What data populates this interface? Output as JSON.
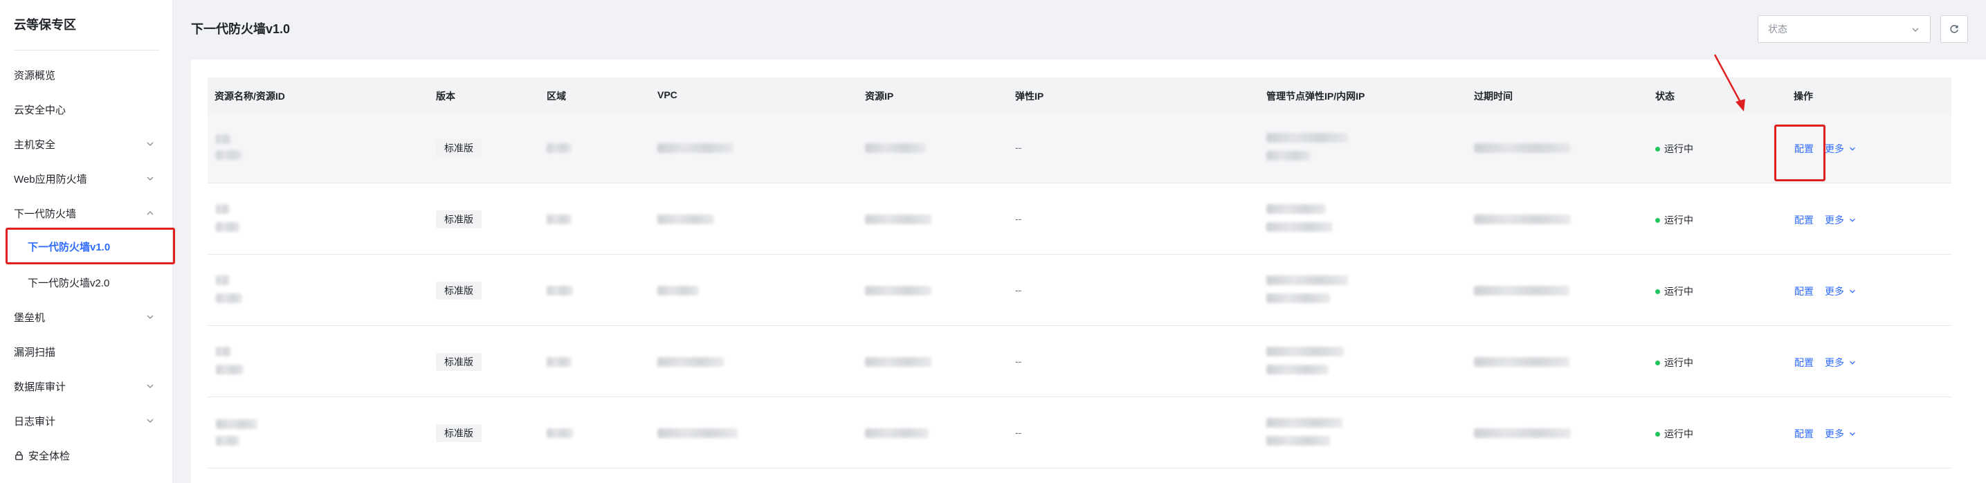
{
  "sidebar": {
    "title": "云等保专区",
    "items": [
      {
        "label": "资源概览",
        "expandable": false
      },
      {
        "label": "云安全中心",
        "expandable": false
      },
      {
        "label": "主机安全",
        "expandable": true
      },
      {
        "label": "Web应用防火墙",
        "expandable": true
      },
      {
        "label": "下一代防火墙",
        "expandable": true,
        "expanded": true
      },
      {
        "label": "下一代防火墙v1.0",
        "sub": true,
        "active": true
      },
      {
        "label": "下一代防火墙v2.0",
        "sub": true
      },
      {
        "label": "堡垒机",
        "expandable": true
      },
      {
        "label": "漏洞扫描",
        "expandable": false
      },
      {
        "label": "数据库审计",
        "expandable": true
      },
      {
        "label": "日志审计",
        "expandable": true
      },
      {
        "label": "安全体检",
        "icon": "lock-icon"
      }
    ]
  },
  "header": {
    "title": "下一代防火墙v1.0",
    "status_placeholder": "状态",
    "refresh_icon": "refresh-icon"
  },
  "table": {
    "columns": [
      "资源名称/资源ID",
      "版本",
      "区域",
      "VPC",
      "资源IP",
      "弹性IP",
      "管理节点弹性IP/内网IP",
      "过期时间",
      "状态",
      "操作"
    ],
    "rows": [
      {
        "version": "标准版",
        "eip": "--",
        "status": "运行中",
        "op_config": "配置",
        "op_more": "更多"
      },
      {
        "version": "标准版",
        "eip": "--",
        "status": "运行中",
        "op_config": "配置",
        "op_more": "更多"
      },
      {
        "version": "标准版",
        "eip": "--",
        "status": "运行中",
        "op_config": "配置",
        "op_more": "更多"
      },
      {
        "version": "标准版",
        "eip": "--",
        "status": "运行中",
        "op_config": "配置",
        "op_more": "更多"
      },
      {
        "version": "标准版",
        "eip": "--",
        "status": "运行中",
        "op_config": "配置",
        "op_more": "更多"
      }
    ]
  },
  "colors": {
    "accent": "#2f6bff",
    "highlight": "#e02020",
    "status_running": "#22c55e"
  }
}
